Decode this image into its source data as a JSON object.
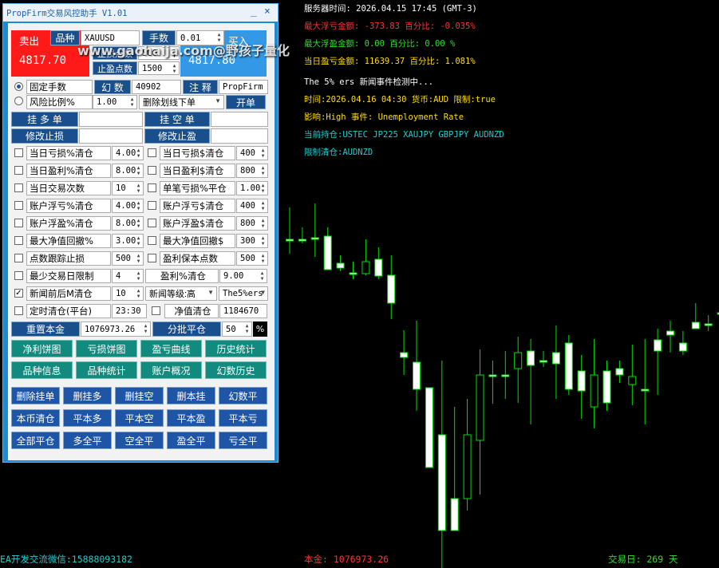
{
  "colors": {
    "bull": "#00e000",
    "bear": "#ffffff",
    "info_white": "#ffffff",
    "info_red": "#ff3333",
    "info_green": "#33dd33",
    "info_yellow": "#ffdd00",
    "info_cyan": "#22cccc",
    "panel_blue": "#1e8bd0"
  },
  "info": {
    "server_time": "服务器时间: 2026.04.15 17:45 (GMT-3)",
    "max_float_loss": "最大浮亏金额: -373.83  百分比: -0.035%",
    "max_float_profit": "最大浮盈金额: 0.00   百分比:  0.00 %",
    "daily_pnl": "当日盈亏金额: 11639.37 百分比: 1.081%",
    "news_title": "The 5% ers 新闻事件检测中...",
    "news_time": "时间:2026.04.16 04:30 货币:AUD 限制:true",
    "news_impact": "影响:High 事件: Unemployment Rate",
    "positions": "当前持仓:USTEC JP225 XAUJPY GBPJPY AUDNZD",
    "limit_close": "限制清仓:AUDNZD"
  },
  "footer": {
    "contact": "EA开发交流微信:15888093182",
    "capital": "本金: 1076973.26",
    "trade_days": "交易日: 269 天"
  },
  "watermark": "www.gaohaija.com@野孩子量化",
  "panel": {
    "title": "PropFirm交易风控助手 V1.01",
    "min_icon": "_",
    "close_icon": "×",
    "sell_label": "卖出",
    "sell_price": "4817.70",
    "symbol_label": "品种",
    "symbol_value": "XAUUSD",
    "lots_label": "手数",
    "lots_value": "0.01",
    "buy_label": "买入",
    "buy_price": "4817.80",
    "sl_points_label": "止损点数",
    "sl_points_value": "500",
    "tp_points_label": "止盈点数",
    "tp_points_value": "1500",
    "fixed_lots_label": "固定手数",
    "magic_label": "幻 数",
    "magic_value": "40902",
    "comment_label": "注 释",
    "comment_value": "PropFirm",
    "risk_pct_label": "风险比例%",
    "risk_pct_value": "1.00",
    "delete_mode": "删除划线下单",
    "open_label": "开单",
    "pend_buy": "挂 多 单",
    "pend_sell": "挂 空 单",
    "modify_sl": "修改止损",
    "modify_tp": "修改止盈",
    "rows": [
      {
        "l": "当日亏损%清仓",
        "lv": "4.00",
        "r": "当日亏损$清仓",
        "rv": "400",
        "lc": false,
        "rc": false
      },
      {
        "l": "当日盈利%清仓",
        "lv": "8.00",
        "r": "当日盈利$清仓",
        "rv": "800",
        "lc": false,
        "rc": false
      },
      {
        "l": "当日交易次数",
        "lv": "10",
        "r": "单笔亏损%平仓",
        "rv": "1.00",
        "lc": false,
        "rc": false
      },
      {
        "l": "账户浮亏%清仓",
        "lv": "4.00",
        "r": "账户浮亏$清仓",
        "rv": "400",
        "lc": false,
        "rc": false
      },
      {
        "l": "账户浮盈%清仓",
        "lv": "8.00",
        "r": "账户浮盈$清仓",
        "rv": "800",
        "lc": false,
        "rc": false
      },
      {
        "l": "最大净值回撤%",
        "lv": "3.00",
        "r": "最大净值回撤$",
        "rv": "300",
        "lc": false,
        "rc": false
      },
      {
        "l": "点数跟踪止损",
        "lv": "500",
        "r": "盈利保本点数",
        "rv": "500",
        "lc": false,
        "rc": false
      }
    ],
    "min_days_label": "最少交易日限制",
    "min_days_value": "4",
    "profit_close_label": "盈利%清仓",
    "profit_close_value": "9.00",
    "news_before_label": "新闻前后M清仓",
    "news_before_value": "10",
    "news_level_label": "新闻等级:高",
    "news_source": "The5%ers",
    "timed_close_label": "定时清仓(平台)",
    "timed_close_value": "23:30",
    "equity_close_label": "净值清仓",
    "equity_close_value": "1184670",
    "reset_capital_label": "重置本金",
    "reset_capital_value": "1076973.26",
    "batch_close_label": "分批平仓",
    "batch_close_value": "50",
    "pct_label": "%",
    "teal_buttons": [
      [
        "净利饼图",
        "亏损饼图",
        "盈亏曲线",
        "历史统计"
      ],
      [
        "品种信息",
        "品种统计",
        "账户概况",
        "幻数历史"
      ]
    ],
    "blue_buttons": [
      [
        "删除挂单",
        "删挂多",
        "删挂空",
        "删本挂",
        "幻数平"
      ],
      [
        "本币清仓",
        "平本多",
        "平本空",
        "平本盈",
        "平本亏"
      ],
      [
        "全部平仓",
        "多全平",
        "空全平",
        "盈全平",
        "亏全平"
      ]
    ]
  },
  "chart_data": {
    "type": "candlestick",
    "candles": [
      {
        "o": 300,
        "h": 260,
        "l": 318,
        "c": 300
      },
      {
        "o": 300,
        "h": 285,
        "l": 305,
        "c": 300
      },
      {
        "o": 298,
        "h": 255,
        "l": 322,
        "c": 298
      },
      {
        "o": 296,
        "h": 285,
        "l": 330,
        "c": 338
      },
      {
        "o": 330,
        "h": 320,
        "l": 340,
        "c": 336
      },
      {
        "o": 342,
        "h": 328,
        "l": 350,
        "c": 342
      },
      {
        "o": 343,
        "h": 300,
        "l": 345,
        "c": 328
      },
      {
        "o": 325,
        "h": 310,
        "l": 350,
        "c": 346
      },
      {
        "o": 345,
        "h": 320,
        "l": 400,
        "c": 380
      },
      {
        "o": 442,
        "h": 414,
        "l": 470,
        "c": 448
      },
      {
        "o": 454,
        "h": 402,
        "l": 515,
        "c": 488
      },
      {
        "o": 486,
        "h": 500,
        "l": 545,
        "c": 586
      },
      {
        "o": 545,
        "h": 452,
        "l": 712,
        "c": 665
      },
      {
        "o": 625,
        "h": 510,
        "l": 665,
        "c": 665
      },
      {
        "o": 625,
        "h": 500,
        "l": 640,
        "c": 545
      },
      {
        "o": 552,
        "h": 438,
        "l": 620,
        "c": 470
      },
      {
        "o": 470,
        "h": 452,
        "l": 506,
        "c": 470
      },
      {
        "o": 470,
        "h": 440,
        "l": 500,
        "c": 470
      },
      {
        "o": 462,
        "h": 422,
        "l": 505,
        "c": 442
      },
      {
        "o": 440,
        "h": 425,
        "l": 532,
        "c": 458
      },
      {
        "o": 452,
        "h": 440,
        "l": 460,
        "c": 452
      },
      {
        "o": 442,
        "h": 408,
        "l": 500,
        "c": 456
      },
      {
        "o": 430,
        "h": 420,
        "l": 495,
        "c": 488
      },
      {
        "o": 465,
        "h": 445,
        "l": 525,
        "c": 490
      },
      {
        "o": 510,
        "h": 425,
        "l": 537,
        "c": 470
      },
      {
        "o": 465,
        "h": 452,
        "l": 515,
        "c": 505
      },
      {
        "o": 462,
        "h": 452,
        "l": 480,
        "c": 470
      },
      {
        "o": 482,
        "h": 432,
        "l": 508,
        "c": 472
      },
      {
        "o": 488,
        "h": 425,
        "l": 532,
        "c": 488
      },
      {
        "o": 426,
        "h": 412,
        "l": 495,
        "c": 440
      },
      {
        "o": 415,
        "h": 402,
        "l": 442,
        "c": 420
      },
      {
        "o": 430,
        "h": 415,
        "l": 445,
        "c": 440
      },
      {
        "o": 404,
        "h": 380,
        "l": 412,
        "c": 412
      },
      {
        "o": 406,
        "h": 395,
        "l": 415,
        "c": 406
      },
      {
        "o": 392,
        "h": 388,
        "l": 405,
        "c": 392
      },
      {
        "o": 392,
        "h": 332,
        "l": 400,
        "c": 350
      },
      {
        "o": 352,
        "h": 330,
        "l": 372,
        "c": 352
      },
      {
        "o": 352,
        "h": 294,
        "l": 358,
        "c": 315
      }
    ]
  }
}
